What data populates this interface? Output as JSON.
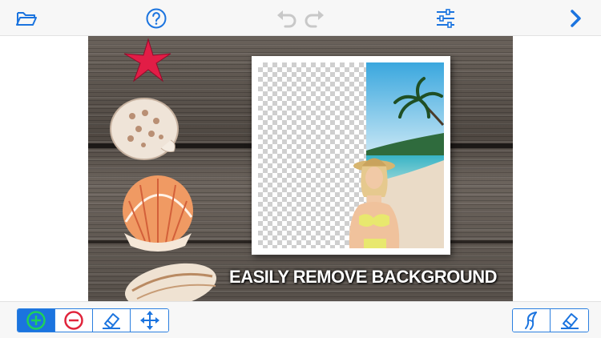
{
  "toolbar": {
    "icons": {
      "open": "folder-icon",
      "help": "help-icon",
      "undo": "undo-icon",
      "redo": "redo-icon",
      "settings": "sliders-icon",
      "next": "chevron-right-icon"
    },
    "colors": {
      "accent": "#1b74df",
      "disabled": "#c8c8c8",
      "add": "#1fd15a",
      "remove": "#e0243b"
    }
  },
  "canvas": {
    "caption": "EASILY REMOVE BACKGROUND"
  },
  "tools": {
    "left": [
      {
        "name": "add-tool",
        "icon": "plus-circle-icon",
        "active": true
      },
      {
        "name": "remove-tool",
        "icon": "minus-circle-icon",
        "active": false
      },
      {
        "name": "eraser-tool",
        "icon": "eraser-icon",
        "active": false
      },
      {
        "name": "move-tool",
        "icon": "move-arrows-icon",
        "active": false
      }
    ],
    "right": [
      {
        "name": "magic-tool",
        "icon": "magic-brush-icon",
        "active": false
      },
      {
        "name": "eraser-tool-right",
        "icon": "eraser-icon",
        "active": false
      }
    ]
  }
}
